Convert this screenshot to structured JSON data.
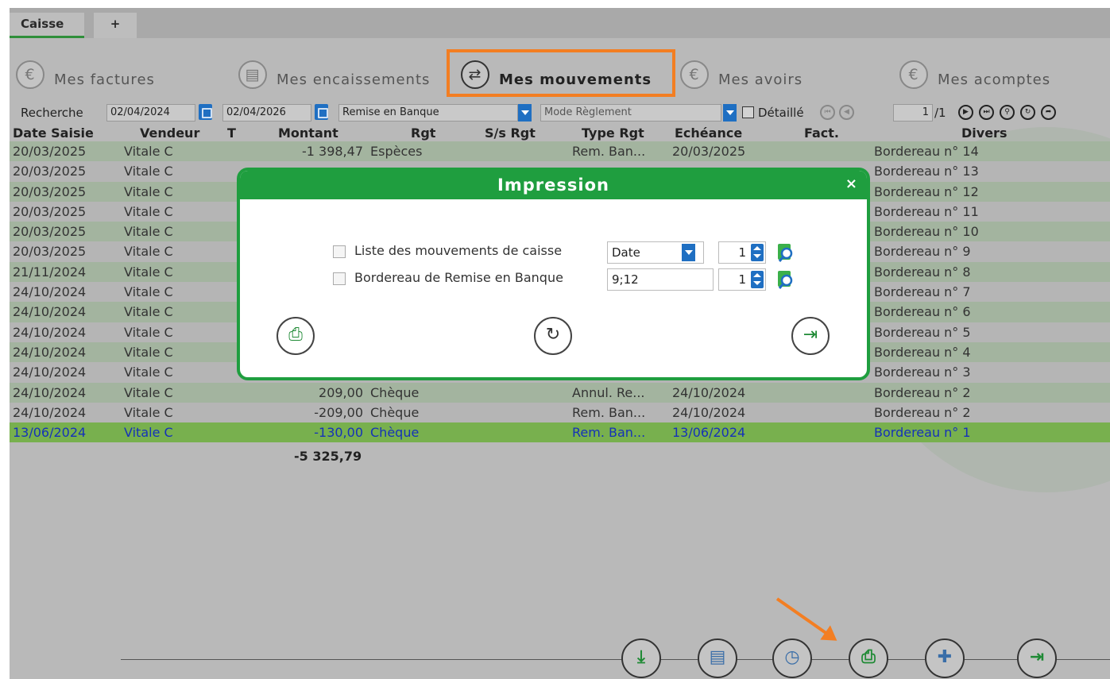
{
  "tabs": {
    "active": "Caisse",
    "add": "+"
  },
  "nav": [
    {
      "label": "Mes factures",
      "icon": "euro-icon"
    },
    {
      "label": "Mes encaissements",
      "icon": "register-icon"
    },
    {
      "label": "Mes mouvements",
      "icon": "transfer-icon"
    },
    {
      "label": "Mes avoirs",
      "icon": "euro-icon"
    },
    {
      "label": "Mes acomptes",
      "icon": "euro-icon"
    }
  ],
  "toolbar": {
    "search_label": "Recherche",
    "date_from": "02/04/2024",
    "date_to": "02/04/2026",
    "type_filter": "Remise en Banque",
    "mode_placeholder": "Mode Règlement",
    "detail_label": "Détaillé",
    "page": "1",
    "pages": "/1"
  },
  "columns": [
    "Date Saisie",
    "Vendeur",
    "T",
    "Montant",
    "Rgt",
    "S/s Rgt",
    "Type Rgt",
    "Echéance",
    "Fact.",
    "Divers"
  ],
  "rows": [
    {
      "date": "20/03/2025",
      "vendeur": "Vitale C",
      "montant": "-1 398,47",
      "rgt": "Espèces",
      "type": "Rem. Ban...",
      "echeance": "20/03/2025",
      "divers": "Bordereau n° 14"
    },
    {
      "date": "20/03/2025",
      "vendeur": "Vitale C",
      "montant": "",
      "rgt": "",
      "type": "",
      "echeance": "",
      "divers": "Bordereau n° 13"
    },
    {
      "date": "20/03/2025",
      "vendeur": "Vitale C",
      "montant": "",
      "rgt": "",
      "type": "",
      "echeance": "",
      "divers": "Bordereau n° 12"
    },
    {
      "date": "20/03/2025",
      "vendeur": "Vitale C",
      "montant": "",
      "rgt": "",
      "type": "",
      "echeance": "",
      "divers": "Bordereau n° 11"
    },
    {
      "date": "20/03/2025",
      "vendeur": "Vitale C",
      "montant": "",
      "rgt": "",
      "type": "",
      "echeance": "",
      "divers": "Bordereau n° 10"
    },
    {
      "date": "20/03/2025",
      "vendeur": "Vitale C",
      "montant": "",
      "rgt": "",
      "type": "",
      "echeance": "",
      "divers": "Bordereau n° 9"
    },
    {
      "date": "21/11/2024",
      "vendeur": "Vitale C",
      "montant": "",
      "rgt": "",
      "type": "",
      "echeance": "",
      "divers": "Bordereau n° 8"
    },
    {
      "date": "24/10/2024",
      "vendeur": "Vitale C",
      "montant": "",
      "rgt": "",
      "type": "",
      "echeance": "",
      "divers": "Bordereau n° 7"
    },
    {
      "date": "24/10/2024",
      "vendeur": "Vitale C",
      "montant": "",
      "rgt": "",
      "type": "",
      "echeance": "",
      "divers": "Bordereau n° 6"
    },
    {
      "date": "24/10/2024",
      "vendeur": "Vitale C",
      "montant": "",
      "rgt": "",
      "type": "",
      "echeance": "",
      "divers": "Bordereau n° 5"
    },
    {
      "date": "24/10/2024",
      "vendeur": "Vitale C",
      "montant": "",
      "rgt": "",
      "type": "",
      "echeance": "",
      "divers": "Bordereau n° 4"
    },
    {
      "date": "24/10/2024",
      "vendeur": "Vitale C",
      "montant": "",
      "rgt": "",
      "type": "",
      "echeance": "",
      "divers": "Bordereau n° 3"
    },
    {
      "date": "24/10/2024",
      "vendeur": "Vitale C",
      "montant": "209,00",
      "rgt": "Chèque",
      "type": "Annul. Re...",
      "echeance": "24/10/2024",
      "divers": "Bordereau n° 2"
    },
    {
      "date": "24/10/2024",
      "vendeur": "Vitale C",
      "montant": "-209,00",
      "rgt": "Chèque",
      "type": "Rem. Ban...",
      "echeance": "24/10/2024",
      "divers": "Bordereau n° 2"
    },
    {
      "date": "13/06/2024",
      "vendeur": "Vitale C",
      "montant": "-130,00",
      "rgt": "Chèque",
      "type": "Rem. Ban...",
      "echeance": "13/06/2024",
      "divers": "Bordereau n° 1"
    }
  ],
  "total": "-5 325,79",
  "dialog": {
    "title": "Impression",
    "close": "×",
    "option1_label": "Liste des mouvements de caisse",
    "option1_sort": "Date",
    "option1_copies": "1",
    "option2_label": "Bordereau de Remise en Banque",
    "option2_value": "9;12",
    "option2_copies": "1"
  },
  "colors": {
    "accent": "#1f9e3f",
    "highlight": "#f37e22",
    "selected_row": "#78b04e",
    "control_blue": "#1f6fc2"
  }
}
